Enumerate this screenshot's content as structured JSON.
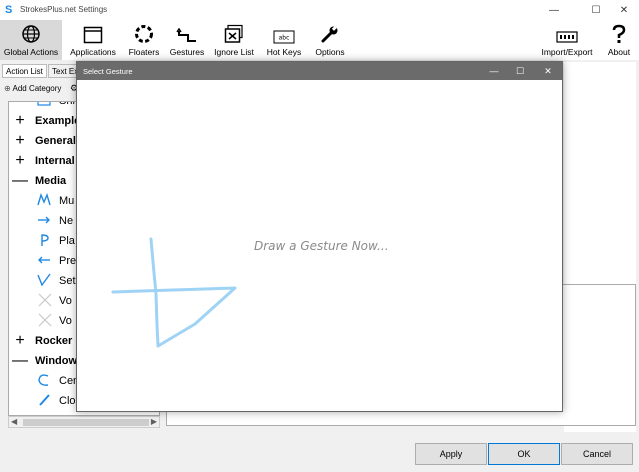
{
  "window": {
    "title": "StrokesPlus.net Settings",
    "minimize": "—",
    "maximize": "☐",
    "close": "✕"
  },
  "toolbar": {
    "items": [
      {
        "label": "Global Actions",
        "icon": "globe-icon",
        "active": true
      },
      {
        "label": "Applications",
        "icon": "window-icon"
      },
      {
        "label": "Floaters",
        "icon": "dashed-circle-icon"
      },
      {
        "label": "Gestures",
        "icon": "gesture-arrow-icon"
      },
      {
        "label": "Ignore List",
        "icon": "ignore-window-icon"
      },
      {
        "label": "Hot Keys",
        "icon": "keyboard-icon"
      },
      {
        "label": "Options",
        "icon": "wrench-icon"
      },
      {
        "label": "Import/Export",
        "icon": "import-export-icon"
      },
      {
        "label": "About",
        "icon": "question-icon"
      }
    ]
  },
  "left_panel": {
    "tabs": [
      "Action List",
      "Text Ex"
    ],
    "add_category": "Add Category",
    "tree": [
      {
        "label": "Sni",
        "type": "action",
        "icon": "snip-icon"
      },
      {
        "label": "Example",
        "type": "category",
        "expander": "+"
      },
      {
        "label": "General",
        "type": "category",
        "expander": "+"
      },
      {
        "label": "Internal",
        "type": "category",
        "expander": "+"
      },
      {
        "label": "Media",
        "type": "category",
        "expander": "—"
      },
      {
        "label": "Mu",
        "type": "action",
        "icon": "m-gesture-icon"
      },
      {
        "label": "Ne",
        "type": "action",
        "icon": "right-arrow-icon"
      },
      {
        "label": "Pla",
        "type": "action",
        "icon": "p-gesture-icon"
      },
      {
        "label": "Pre",
        "type": "action",
        "icon": "left-arrow-icon"
      },
      {
        "label": "Set",
        "type": "action",
        "icon": "v-gesture-icon"
      },
      {
        "label": "Vo",
        "type": "action",
        "icon": "x-icon"
      },
      {
        "label": "Vo",
        "type": "action",
        "icon": "x-icon"
      },
      {
        "label": "Rocker",
        "type": "category",
        "expander": "+"
      },
      {
        "label": "Window",
        "type": "category",
        "expander": "—"
      },
      {
        "label": "Cen",
        "type": "action",
        "icon": "c-gesture-icon"
      },
      {
        "label": "Close",
        "type": "action",
        "icon": "slash-gesture-icon"
      }
    ]
  },
  "dialog": {
    "title": "Select Gesture",
    "prompt": "Draw a Gesture Now...",
    "gesture_color": "#9fd3f5"
  },
  "footer": {
    "apply": "Apply",
    "ok": "OK",
    "cancel": "Cancel"
  },
  "colors": {
    "accent": "#0078d7",
    "dialog_title_bg": "#6b6b6b",
    "gesture_icon": "#1e88e5"
  }
}
